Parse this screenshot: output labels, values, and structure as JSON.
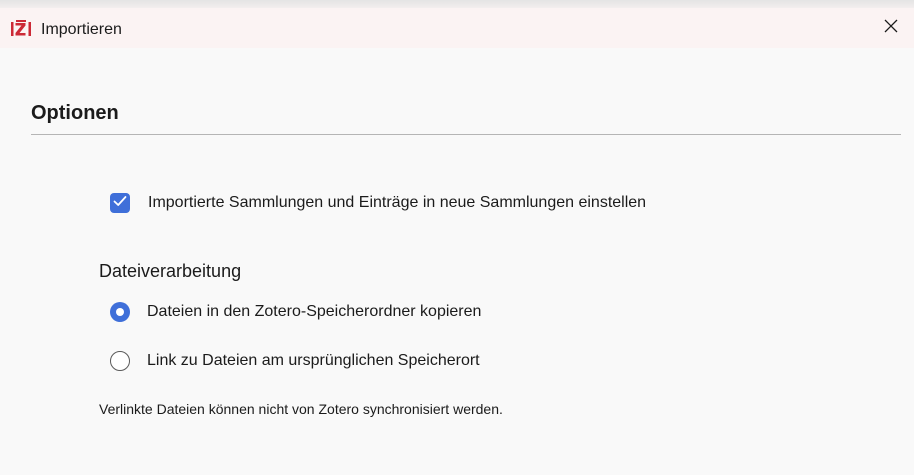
{
  "window": {
    "title": "Importieren",
    "close_glyph": "✕",
    "app_icon": "zotero-z-icon"
  },
  "options": {
    "section_title": "Optionen",
    "create_collections": {
      "label": "Importierte Sammlungen und Einträge in neue Sammlungen einstellen",
      "checked": true
    },
    "file_handling": {
      "title": "Dateiverarbeitung",
      "choices": [
        {
          "label": "Dateien in den Zotero-Speicherordner kopieren",
          "selected": true
        },
        {
          "label": "Link zu Dateien am ursprünglichen Speicherort",
          "selected": false
        }
      ]
    },
    "note": "Verlinkte Dateien können nicht von Zotero synchronisiert werden."
  },
  "colors": {
    "accent": "#3f6fd9",
    "zotero_red": "#cc2936",
    "titlebar_bg": "#fbf3f3",
    "content_bg": "#f9f9f9"
  }
}
